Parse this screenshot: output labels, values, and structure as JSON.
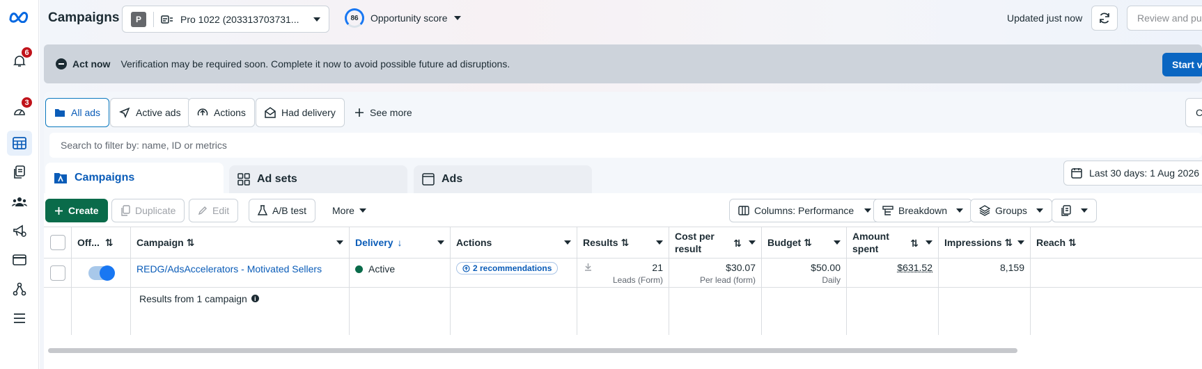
{
  "nav": {
    "notifications_badge": "6",
    "perf_badge": "3"
  },
  "header": {
    "title": "Campaigns",
    "account_initial": "P",
    "account_name": "Pro 1022 (203313703731...",
    "opportunity_score": "86",
    "opportunity_label": "Opportunity score",
    "updated": "Updated just now",
    "review_label": "Review and publish"
  },
  "alert": {
    "title": "Act now",
    "message": "Verification may be required soon. Complete it now to avoid possible future ad disruptions.",
    "action": "Start verification"
  },
  "filters": {
    "chips": [
      "All ads",
      "Active ads",
      "Actions",
      "Had delivery"
    ],
    "see_more": "See more",
    "create_view": "Create view"
  },
  "search": {
    "placeholder": "Search to filter by: name, ID or metrics"
  },
  "level_tabs": [
    "Campaigns",
    "Ad sets",
    "Ads"
  ],
  "date_range": "Last 30 days: 1 Aug 2026",
  "toolbar": {
    "create": "Create",
    "duplicate": "Duplicate",
    "edit": "Edit",
    "ab_test": "A/B test",
    "more": "More",
    "columns": "Columns: Performance",
    "breakdown": "Breakdown",
    "groups": "Groups"
  },
  "table": {
    "headers": {
      "off_on": "Off...",
      "campaign": "Campaign",
      "delivery": "Delivery",
      "actions": "Actions",
      "results": "Results",
      "cost_per_result": "Cost per result",
      "budget": "Budget",
      "amount_spent": "Amount spent",
      "impressions": "Impressions",
      "reach": "Reach"
    },
    "row": {
      "campaign": "REDG/AdsAccelerators - Motivated Sellers",
      "delivery": "Active",
      "actions": "2 recommendations",
      "results": "21",
      "results_sub": "Leads (Form)",
      "cost_per_result": "$30.07",
      "cost_sub": "Per lead (form)",
      "budget": "$50.00",
      "budget_sub": "Daily",
      "amount_spent": "$631.52",
      "impressions": "8,159",
      "reach": ""
    },
    "footer": "Results from 1 campaign"
  },
  "colors": {
    "primary": "#0a5cb8",
    "create": "#0a6b4a",
    "alert_bg": "#cdd3db",
    "badge": "#c0121a"
  }
}
